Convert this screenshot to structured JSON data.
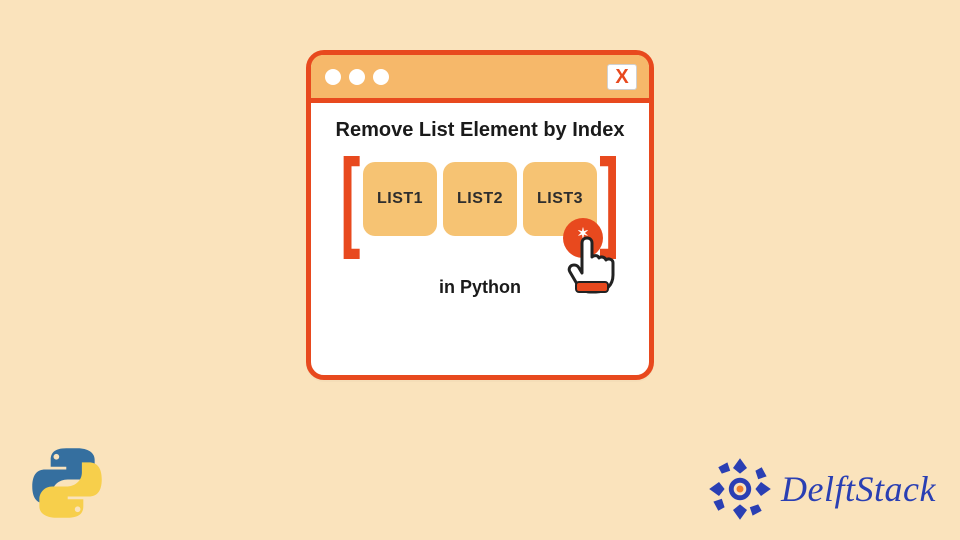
{
  "window": {
    "close_label": "X",
    "heading": "Remove List Element by Index",
    "subtitle": "in Python",
    "list_items": [
      "LIST1",
      "LIST2",
      "LIST3"
    ],
    "bracket_left": "[",
    "bracket_right": "]"
  },
  "brand": {
    "name": "DelftStack"
  },
  "icons": {
    "python": "python-logo",
    "brand_badge": "delftstack-badge",
    "cursor": "pointer-hand",
    "close": "close-x"
  },
  "colors": {
    "background": "#fae3bc",
    "accent": "#e8491e",
    "tile": "#f6c373",
    "brand": "#2a3fb3"
  }
}
